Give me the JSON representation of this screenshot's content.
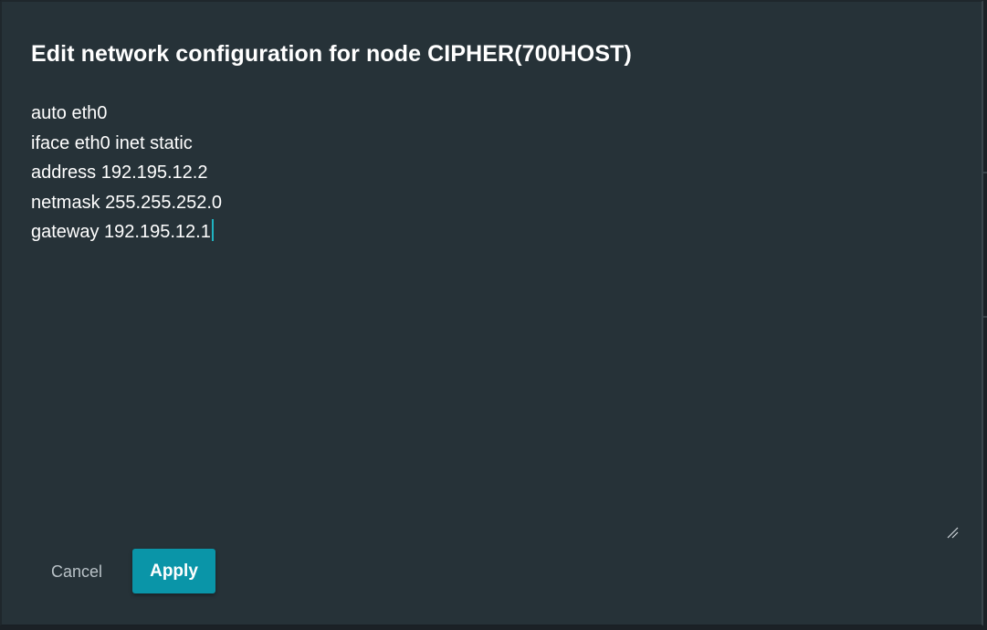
{
  "dialog": {
    "title": "Edit network configuration for node CIPHER(700HOST)",
    "config_lines": [
      "auto eth0",
      "iface eth0 inet static",
      "address 192.195.12.2",
      "netmask 255.255.252.0",
      "gateway 192.195.12.1"
    ],
    "cancel_label": "Cancel",
    "apply_label": "Apply"
  },
  "colors": {
    "dialog_background": "#263238",
    "accent": "#0a95a8",
    "caret": "#1fb3c1",
    "text": "#ffffff",
    "muted_text": "#b9c2c7"
  },
  "icons": {
    "resize_handle": "resize-grip-icon"
  }
}
